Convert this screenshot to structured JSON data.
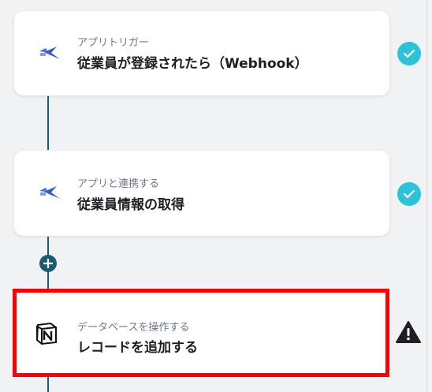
{
  "flow": {
    "steps": [
      {
        "subtitle": "アプリトリガー",
        "title": "従業員が登録されたら（Webhook）",
        "app_icon": "swallow-bird-icon",
        "status_icon": "check-circle-icon"
      },
      {
        "subtitle": "アプリと連携する",
        "title": "従業員情報の取得",
        "app_icon": "swallow-bird-icon",
        "status_icon": "check-circle-icon"
      },
      {
        "subtitle": "データベースを操作する",
        "title": "レコードを追加する",
        "app_icon": "notion-icon",
        "status_icon": "warning-triangle-icon",
        "highlighted": true
      }
    ],
    "add_step_icon": "plus-circle-icon"
  },
  "colors": {
    "background": "#f1f2f4",
    "connector": "#1f5a73",
    "check": "#2cc3d8",
    "highlight_border": "#ff0000",
    "warning": "#1d1f23"
  }
}
